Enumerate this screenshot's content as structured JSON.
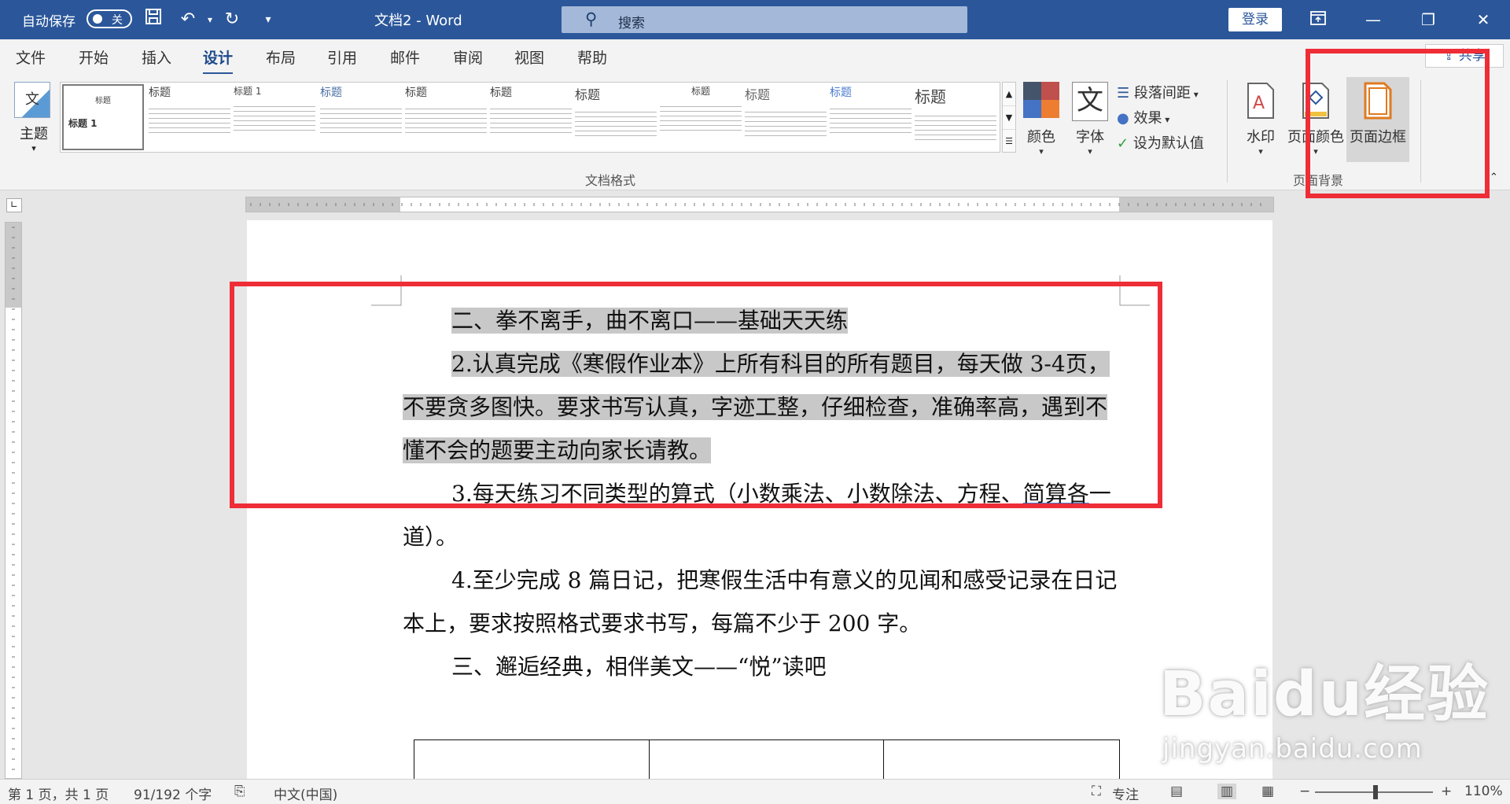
{
  "titlebar": {
    "autosave_label": "自动保存",
    "autosave_state": "关",
    "title": "文档2 - Word",
    "search_placeholder": "搜索",
    "login": "登录"
  },
  "tabs": [
    "文件",
    "开始",
    "插入",
    "设计",
    "布局",
    "引用",
    "邮件",
    "审阅",
    "视图",
    "帮助"
  ],
  "active_tab": "设计",
  "share_label": "共享",
  "ribbon": {
    "theme_label": "主题",
    "gallery_heading": "标题",
    "gallery_title_1": "标题 1",
    "group_doc_format": "文档格式",
    "colors_label": "颜色",
    "fonts_label": "字体",
    "paragraph_spacing": "段落间距",
    "effects": "效果",
    "set_default": "设为默认值",
    "watermark": "水印",
    "page_color": "页面颜色",
    "page_borders": "页面边框",
    "group_page_background": "页面背景",
    "font_icon_char": "文"
  },
  "document": {
    "p1": "二、拳不离手，曲不离口——基础天天练",
    "p2": "2.认真完成《寒假作业本》上所有科目的所有题目，每天做 3-4页，不要贪多图快。要求书写认真，字迹工整，仔细检查，准确率高，遇到不懂不会的题要主动向家长请教。",
    "p3_a": "3.每天练习不同类型的算式（小数乘法、小数除法、方程、",
    "p3_ul": "简算各",
    "p3_b": "一道）。",
    "p4": "4.至少完成 8 篇日记，把寒假生活中有意义的见闻和感受记录在日记本上，要求按照格式要求书写，每篇不少于 200 字。",
    "p5": "三、邂逅经典，相伴美文——“悦”读吧"
  },
  "status": {
    "page": "第 1 页，共 1 页",
    "words": "91/192 个字",
    "language": "中文(中国)",
    "focus": "专注",
    "zoom": "110%"
  },
  "watermark": {
    "brand": "Baidu经验",
    "url": "jingyan.baidu.com"
  },
  "colors": {
    "title_bar": "#2b579a",
    "annotation_red": "#ee2d37",
    "highlight": "#c8c8c8"
  }
}
